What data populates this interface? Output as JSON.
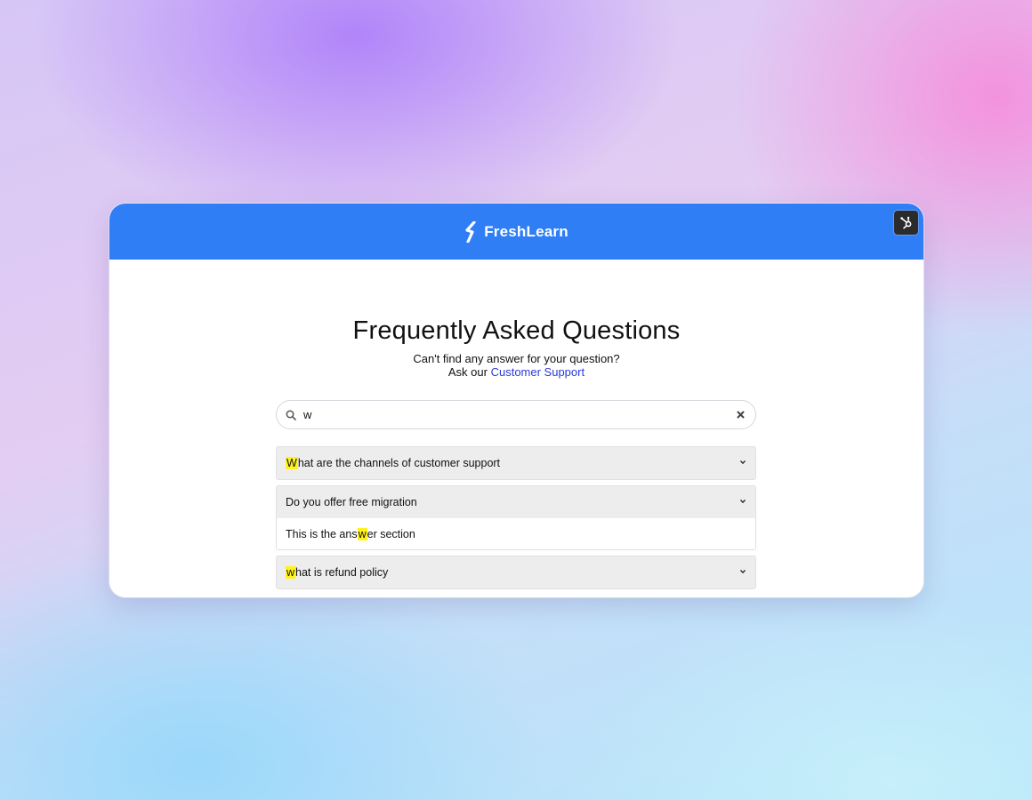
{
  "header": {
    "brand_name": "FreshLearn",
    "accent_color": "#2f7ef6",
    "badge_icon": "hubspot-icon"
  },
  "hero": {
    "title": "Frequently Asked Questions",
    "subtitle_line1": "Can't find any answer for your question?",
    "subtitle_line2_prefix": "Ask our",
    "support_link": "Customer Support"
  },
  "search": {
    "value": "w",
    "icon": "search-icon",
    "clear_icon": "close-icon"
  },
  "faq": {
    "items": [
      {
        "highlight": "W",
        "rest": "hat are the channels of customer support",
        "expanded": false
      },
      {
        "question": "Do you offer free migration",
        "expanded": true,
        "answer_before": "This is the ans",
        "answer_highlight": "w",
        "answer_after": "er section"
      },
      {
        "highlight": "w",
        "rest": "hat is refund policy",
        "expanded": false
      }
    ],
    "highlight_color": "#fff21f"
  }
}
